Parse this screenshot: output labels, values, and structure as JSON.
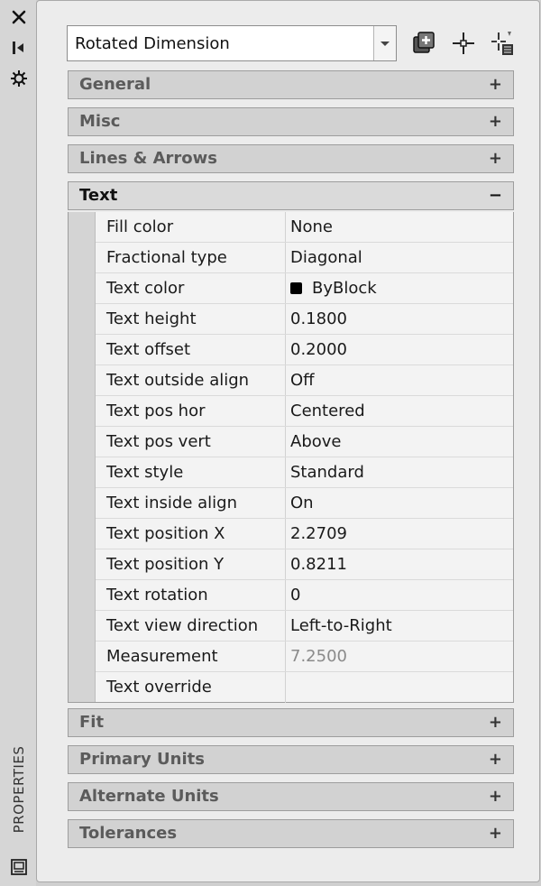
{
  "window": {
    "title": "PROPERTIES",
    "strip_icons": [
      "close-icon",
      "auto-hide-icon",
      "settings-icon",
      "properties-palette-icon"
    ]
  },
  "selector": {
    "value": "Rotated Dimension",
    "toolbar": [
      "toggle-pickadd-icon",
      "select-objects-icon",
      "quick-select-icon"
    ]
  },
  "sections_top": [
    {
      "title": "General",
      "toggle": "+"
    },
    {
      "title": "Misc",
      "toggle": "+"
    },
    {
      "title": "Lines & Arrows",
      "toggle": "+"
    }
  ],
  "open_section": {
    "title": "Text",
    "toggle": "−",
    "properties": [
      {
        "name": "Fill color",
        "value": "None"
      },
      {
        "name": "Fractional type",
        "value": "Diagonal"
      },
      {
        "name": "Text color",
        "value": "ByBlock",
        "swatch": "#000000"
      },
      {
        "name": "Text height",
        "value": "0.1800"
      },
      {
        "name": "Text offset",
        "value": "0.2000"
      },
      {
        "name": "Text outside align",
        "value": "Off"
      },
      {
        "name": "Text pos hor",
        "value": "Centered"
      },
      {
        "name": "Text pos vert",
        "value": "Above"
      },
      {
        "name": "Text style",
        "value": "Standard"
      },
      {
        "name": "Text inside align",
        "value": "On"
      },
      {
        "name": "Text position X",
        "value": "2.2709"
      },
      {
        "name": "Text position Y",
        "value": "0.8211"
      },
      {
        "name": "Text rotation",
        "value": "0"
      },
      {
        "name": "Text view direction",
        "value": "Left-to-Right"
      },
      {
        "name": "Measurement",
        "value": "7.2500",
        "readonly": true
      },
      {
        "name": "Text override",
        "value": ""
      }
    ]
  },
  "sections_bottom": [
    {
      "title": "Fit",
      "toggle": "+"
    },
    {
      "title": "Primary Units",
      "toggle": "+"
    },
    {
      "title": "Alternate Units",
      "toggle": "+"
    },
    {
      "title": "Tolerances",
      "toggle": "+"
    }
  ],
  "colors": {
    "panel_bg": "#ececec",
    "section_bg": "#d2d2d2",
    "readonly_text": "#8a8a8a"
  }
}
